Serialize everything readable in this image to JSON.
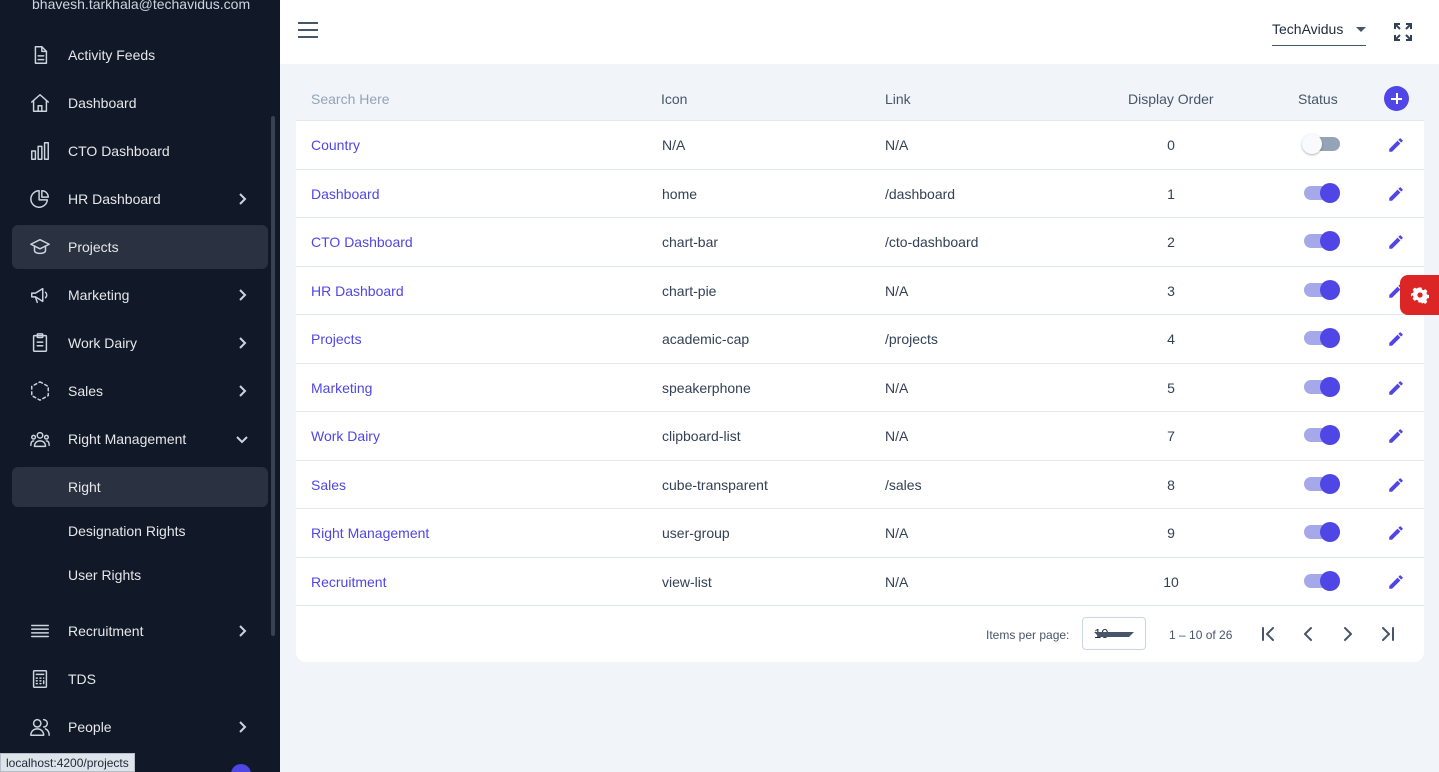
{
  "user": {
    "email": "bhavesh.tarkhala@techavidus.com"
  },
  "sidebar": {
    "items": [
      {
        "label": "Activity Feeds",
        "icon": "document-icon"
      },
      {
        "label": "Dashboard",
        "icon": "home-icon"
      },
      {
        "label": "CTO Dashboard",
        "icon": "chart-bar-icon"
      },
      {
        "label": "HR Dashboard",
        "icon": "chart-pie-icon",
        "expandable": true
      },
      {
        "label": "Projects",
        "icon": "academic-cap-icon",
        "active": true
      },
      {
        "label": "Marketing",
        "icon": "speakerphone-icon",
        "expandable": true
      },
      {
        "label": "Work Dairy",
        "icon": "clipboard-list-icon",
        "expandable": true
      },
      {
        "label": "Sales",
        "icon": "cube-transparent-icon",
        "expandable": true
      },
      {
        "label": "Right Management",
        "icon": "user-group-icon",
        "expanded": true
      },
      {
        "label": "Recruitment",
        "icon": "view-list-icon",
        "expandable": true
      },
      {
        "label": "TDS",
        "icon": "calculator-icon"
      },
      {
        "label": "People",
        "icon": "users-icon",
        "expandable": true
      }
    ],
    "sub_items": [
      {
        "label": "Right",
        "active": true
      },
      {
        "label": "Designation Rights"
      },
      {
        "label": "User Rights"
      }
    ],
    "status_url": "localhost:4200/projects"
  },
  "header": {
    "company": "TechAvidus"
  },
  "table": {
    "search_placeholder": "Search Here",
    "columns": {
      "icon": "Icon",
      "link": "Link",
      "order": "Display Order",
      "status": "Status"
    },
    "rows": [
      {
        "name": "Country",
        "icon": "N/A",
        "link": "N/A",
        "order": "0",
        "status": false
      },
      {
        "name": "Dashboard",
        "icon": "home",
        "link": "/dashboard",
        "order": "1",
        "status": true
      },
      {
        "name": "CTO Dashboard",
        "icon": "chart-bar",
        "link": "/cto-dashboard",
        "order": "2",
        "status": true
      },
      {
        "name": "HR Dashboard",
        "icon": "chart-pie",
        "link": "N/A",
        "order": "3",
        "status": true
      },
      {
        "name": "Projects",
        "icon": "academic-cap",
        "link": "/projects",
        "order": "4",
        "status": true
      },
      {
        "name": "Marketing",
        "icon": "speakerphone",
        "link": "N/A",
        "order": "5",
        "status": true
      },
      {
        "name": "Work Dairy",
        "icon": "clipboard-list",
        "link": "N/A",
        "order": "7",
        "status": true
      },
      {
        "name": "Sales",
        "icon": "cube-transparent",
        "link": "/sales",
        "order": "8",
        "status": true
      },
      {
        "name": "Right Management",
        "icon": "user-group",
        "link": "N/A",
        "order": "9",
        "status": true
      },
      {
        "name": "Recruitment",
        "icon": "view-list",
        "link": "N/A",
        "order": "10",
        "status": true
      }
    ]
  },
  "pagination": {
    "items_per_page_label": "Items per page:",
    "page_size": "10",
    "range": "1 – 10 of 26"
  },
  "colors": {
    "accent": "#4f46e5",
    "sidebar_bg": "#111827",
    "settings_tab": "#dc2626"
  }
}
